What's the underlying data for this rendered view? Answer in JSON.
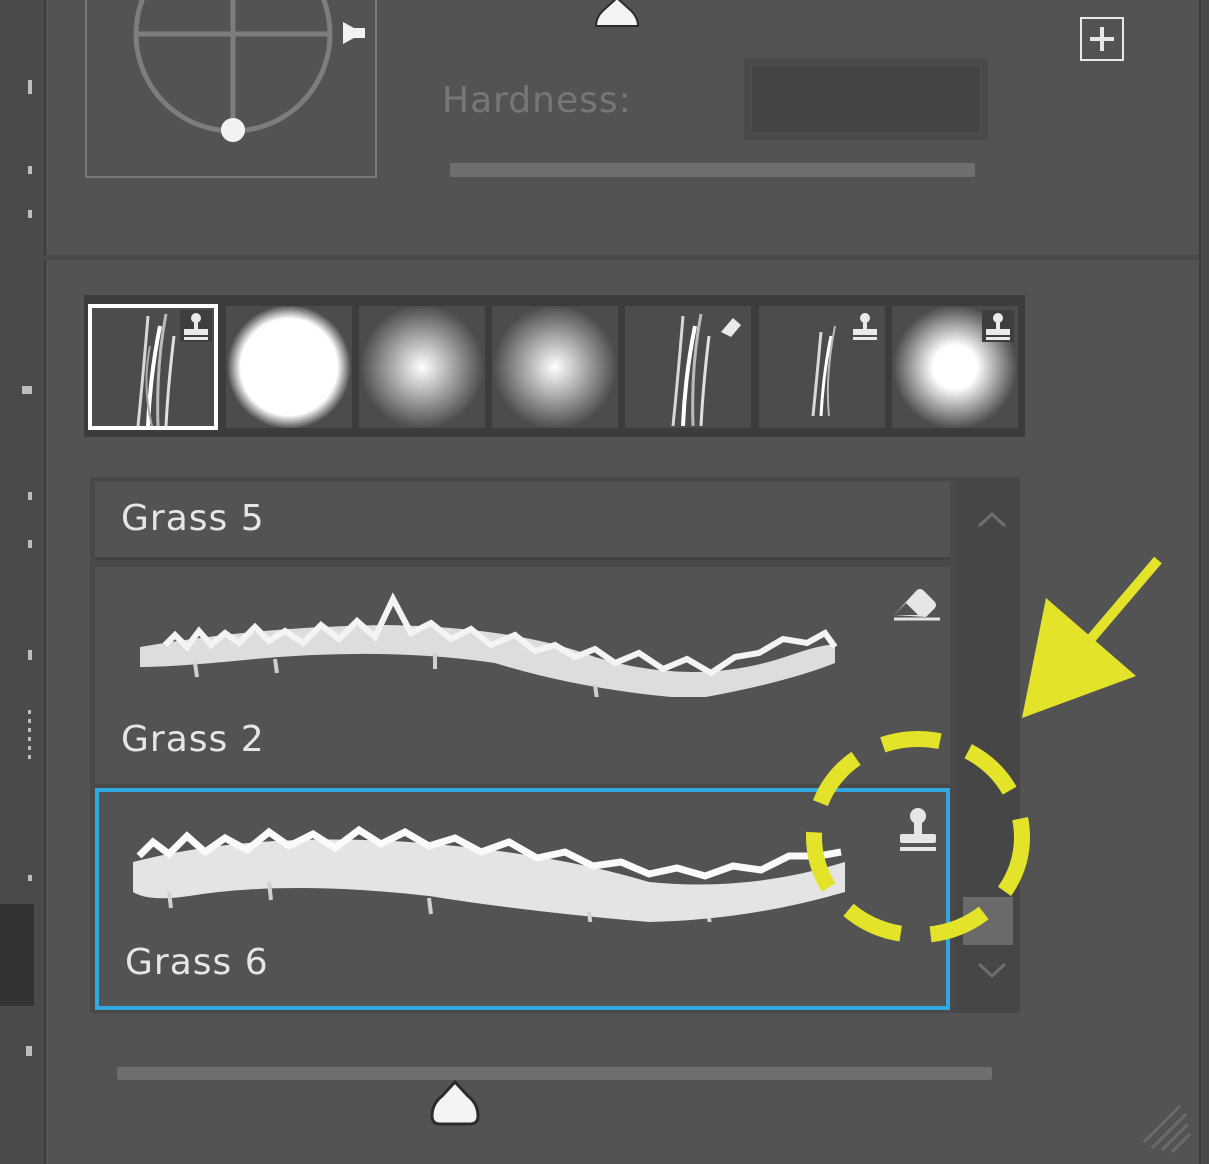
{
  "brush_options": {
    "hardness_label": "Hardness:",
    "hardness_value": ""
  },
  "presets": [
    {
      "icon": "grass-brush-icon",
      "badge": "stamp-icon",
      "selected": true
    },
    {
      "icon": "hard-round-brush-icon",
      "badge": "",
      "selected": false
    },
    {
      "icon": "soft-round-brush-icon",
      "badge": "",
      "selected": false
    },
    {
      "icon": "soft-round-brush-icon",
      "badge": "",
      "selected": false
    },
    {
      "icon": "grass-brush-icon",
      "badge": "eraser-icon",
      "selected": false
    },
    {
      "icon": "grass-brush-icon",
      "badge": "stamp-icon",
      "selected": false
    },
    {
      "icon": "soft-round-brush-icon",
      "badge": "stamp-icon",
      "selected": false
    }
  ],
  "brush_list": {
    "items": [
      {
        "label": "Grass 5",
        "icon": "",
        "selected": false
      },
      {
        "label": "Grass 2",
        "icon": "eraser-icon",
        "selected": false
      },
      {
        "label": "Grass 6",
        "icon": "stamp-icon",
        "selected": true
      }
    ]
  },
  "colors": {
    "panel_bg": "#535353",
    "selection_border": "#31a8e0",
    "annotation": "#e6e62a"
  }
}
